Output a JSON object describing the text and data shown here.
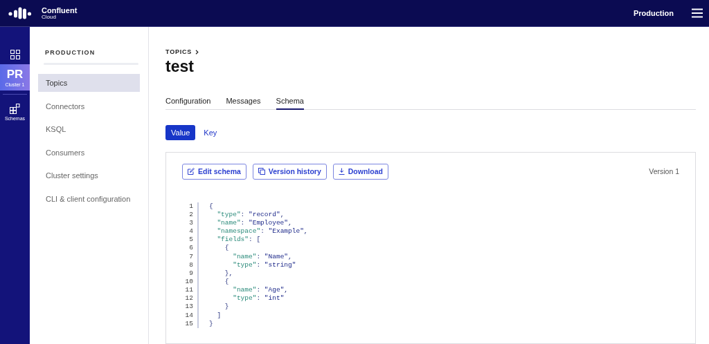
{
  "header": {
    "brand": "Confluent",
    "brand_sub": "Cloud",
    "environment": "Production"
  },
  "rail": {
    "items": [
      {
        "kind": "icon",
        "selected": false
      },
      {
        "kind": "cluster",
        "badge": "PR",
        "label": "Cluster 1",
        "selected": true
      },
      {
        "kind": "schemas",
        "label": "Schemas",
        "selected": false
      }
    ]
  },
  "sidebar": {
    "heading": "PRODUCTION",
    "items": [
      {
        "label": "Topics",
        "selected": true
      },
      {
        "label": "Connectors",
        "selected": false
      },
      {
        "label": "KSQL",
        "selected": false
      },
      {
        "label": "Consumers",
        "selected": false
      },
      {
        "label": "Cluster settings",
        "selected": false
      },
      {
        "label": "CLI & client configuration",
        "selected": false
      }
    ]
  },
  "breadcrumb": "TOPICS",
  "title": "test",
  "tabs": [
    {
      "label": "Configuration",
      "selected": false
    },
    {
      "label": "Messages",
      "selected": false
    },
    {
      "label": "Schema",
      "selected": true
    }
  ],
  "subtabs": [
    {
      "label": "Value",
      "selected": true
    },
    {
      "label": "Key",
      "selected": false
    }
  ],
  "toolbar": {
    "buttons": [
      {
        "kind": "edit",
        "label": "Edit schema"
      },
      {
        "kind": "history",
        "label": "Version history"
      },
      {
        "kind": "download",
        "label": "Download"
      }
    ],
    "version": "Version 1"
  },
  "code": [
    {
      "number": "1",
      "segments": [
        {
          "kind": "punct",
          "text": "{"
        }
      ]
    },
    {
      "number": "2",
      "segments": [
        {
          "kind": "key",
          "text": "  \"type\""
        },
        {
          "kind": "punct",
          "text": ": "
        },
        {
          "kind": "string",
          "text": "\"record\""
        },
        {
          "kind": "punct",
          "text": ","
        }
      ]
    },
    {
      "number": "3",
      "segments": [
        {
          "kind": "key",
          "text": "  \"name\""
        },
        {
          "kind": "punct",
          "text": ": "
        },
        {
          "kind": "string",
          "text": "\"Employee\""
        },
        {
          "kind": "punct",
          "text": ","
        }
      ]
    },
    {
      "number": "4",
      "segments": [
        {
          "kind": "key",
          "text": "  \"namespace\""
        },
        {
          "kind": "punct",
          "text": ": "
        },
        {
          "kind": "string",
          "text": "\"Example\""
        },
        {
          "kind": "punct",
          "text": ","
        }
      ]
    },
    {
      "number": "5",
      "segments": [
        {
          "kind": "key",
          "text": "  \"fields\""
        },
        {
          "kind": "punct",
          "text": ": ["
        }
      ]
    },
    {
      "number": "6",
      "segments": [
        {
          "kind": "punct",
          "text": "    {"
        }
      ]
    },
    {
      "number": "7",
      "segments": [
        {
          "kind": "key",
          "text": "      \"name\""
        },
        {
          "kind": "punct",
          "text": ": "
        },
        {
          "kind": "string",
          "text": "\"Name\""
        },
        {
          "kind": "punct",
          "text": ","
        }
      ]
    },
    {
      "number": "8",
      "segments": [
        {
          "kind": "key",
          "text": "      \"type\""
        },
        {
          "kind": "punct",
          "text": ": "
        },
        {
          "kind": "string",
          "text": "\"string\""
        }
      ]
    },
    {
      "number": "9",
      "segments": [
        {
          "kind": "punct",
          "text": "    },"
        }
      ]
    },
    {
      "number": "10",
      "segments": [
        {
          "kind": "punct",
          "text": "    {"
        }
      ]
    },
    {
      "number": "11",
      "segments": [
        {
          "kind": "key",
          "text": "      \"name\""
        },
        {
          "kind": "punct",
          "text": ": "
        },
        {
          "kind": "string",
          "text": "\"Age\""
        },
        {
          "kind": "punct",
          "text": ","
        }
      ]
    },
    {
      "number": "12",
      "segments": [
        {
          "kind": "key",
          "text": "      \"type\""
        },
        {
          "kind": "punct",
          "text": ": "
        },
        {
          "kind": "string",
          "text": "\"int\""
        }
      ]
    },
    {
      "number": "13",
      "segments": [
        {
          "kind": "punct",
          "text": "    }"
        }
      ]
    },
    {
      "number": "14",
      "segments": [
        {
          "kind": "punct",
          "text": "  ]"
        }
      ]
    },
    {
      "number": "15",
      "segments": [
        {
          "kind": "punct",
          "text": "}"
        }
      ]
    }
  ]
}
